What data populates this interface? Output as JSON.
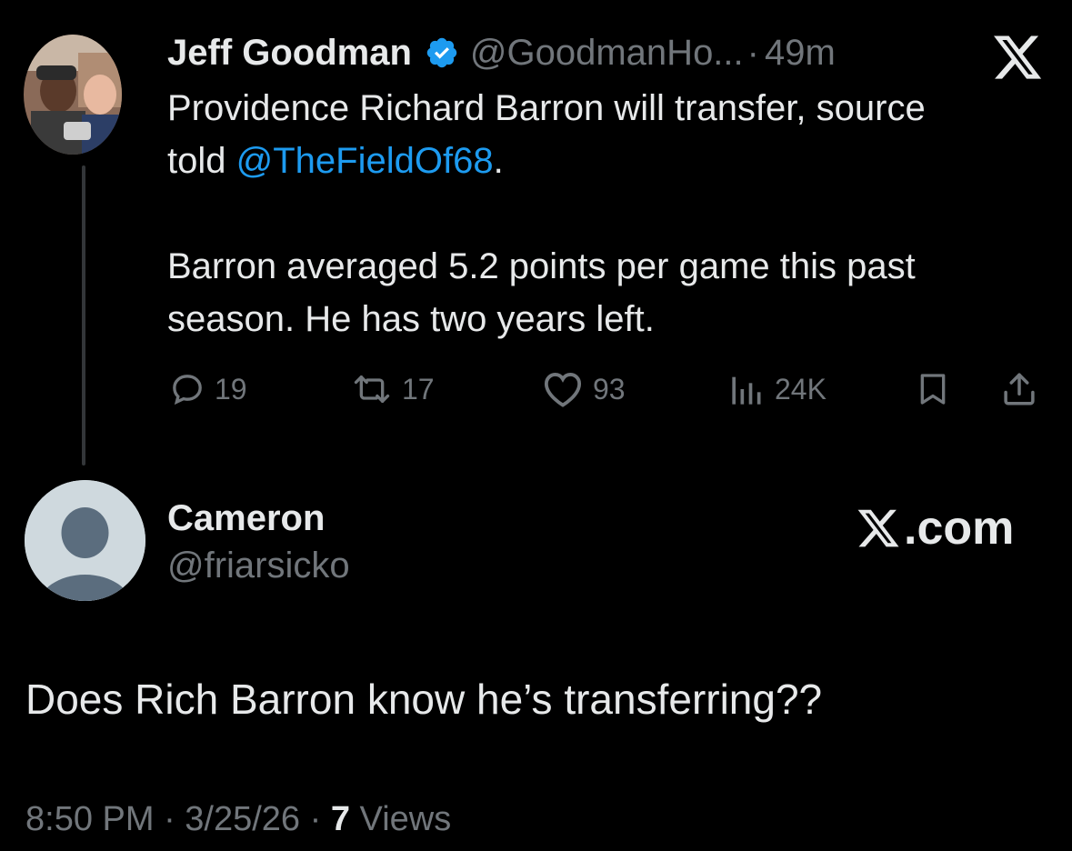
{
  "parent_tweet": {
    "author_name": "Jeff Goodman",
    "handle": "@GoodmanHo...",
    "separator": "·",
    "time": "49m",
    "avatar_icon": "profile-photo",
    "verified_icon": "verified-badge-icon",
    "brand_icon": "x-logo-icon",
    "text_line_1": "Providence Richard Barron will transfer, source",
    "text_line_2_prefix": "told ",
    "mention": "@TheFieldOf68",
    "text_line_2_suffix": ".",
    "text_line_3": "Barron averaged 5.2 points per game this past",
    "text_line_4": "season. He has two years left.",
    "actions": {
      "replies": "19",
      "reposts": "17",
      "likes": "93",
      "views": "24K"
    }
  },
  "reply_tweet": {
    "author_name": "Cameron",
    "handle": "@friarsicko",
    "brand_text": ".com",
    "text": "Does Rich Barron know he’s transferring??",
    "footer": {
      "timestamp": "8:50 PM · 3/25/26 · ",
      "views_count": "7",
      "views_label": " Views"
    }
  },
  "colors": {
    "background": "#000000",
    "text_primary": "#e7e9ea",
    "text_secondary": "#71767b",
    "link": "#1d9bf0",
    "verified": "#1d9bf0",
    "thread_line": "#333639",
    "default_avatar_bg": "#cfd9de",
    "default_avatar_fg": "#5b6d7e"
  }
}
